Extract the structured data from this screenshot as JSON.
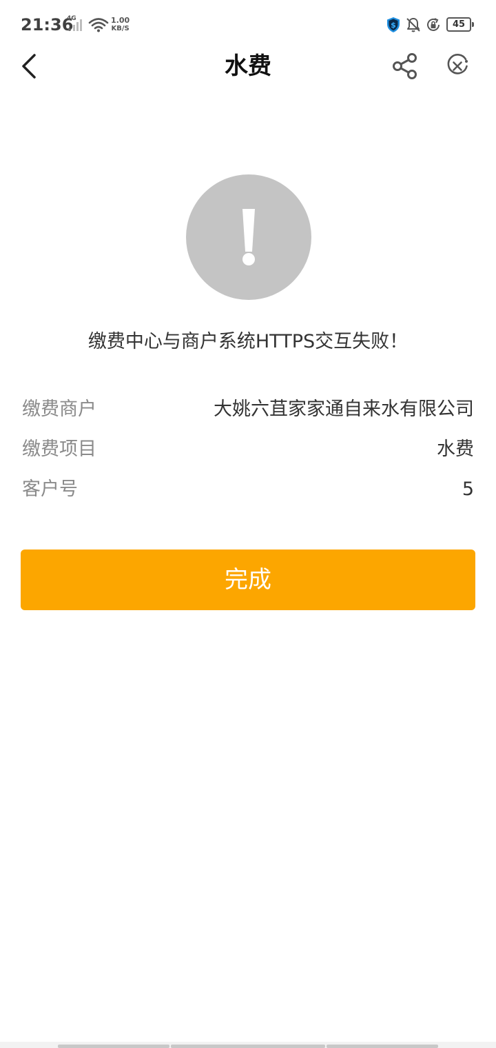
{
  "status_bar": {
    "time": "21:36",
    "network": "4G",
    "speed_value": "1.00",
    "speed_unit": "KB/S",
    "battery": "45",
    "icons": [
      "signal-icon",
      "wifi-icon",
      "shield-dollar-icon",
      "bell-off-icon",
      "lock-rotation-icon",
      "battery-icon"
    ]
  },
  "nav": {
    "title": "水费",
    "icons": [
      "back-chevron-icon",
      "share-icon",
      "close-circle-icon"
    ]
  },
  "result": {
    "icon": "exclamation-icon",
    "icon_color": "#c4c4c4",
    "message": "缴费中心与商户系统HTTPS交互失败！"
  },
  "info": {
    "rows": [
      {
        "label": "缴费商户",
        "value": "大姚六苴家家通自来水有限公司"
      },
      {
        "label": "缴费项目",
        "value": "水费"
      },
      {
        "label": "客户号",
        "value": "5"
      }
    ]
  },
  "actions": {
    "done_label": "完成",
    "accent_color": "#fca600"
  }
}
